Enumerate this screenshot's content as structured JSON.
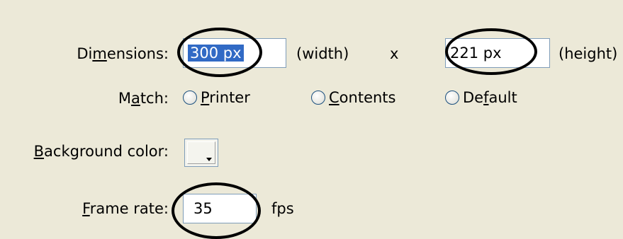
{
  "dimensions": {
    "label_prefix": "Di",
    "label_mnemonic": "m",
    "label_suffix": "ensions:",
    "width_value": "300 px",
    "width_unit": "(width)",
    "separator": "x",
    "height_value": "221 px",
    "height_unit": "(height)"
  },
  "match": {
    "label_prefix": "M",
    "label_mnemonic": "a",
    "label_suffix": "tch:",
    "options": [
      {
        "mnemonic": "P",
        "rest": "rinter"
      },
      {
        "mnemonic": "C",
        "rest": "ontents"
      },
      {
        "prefix": "De",
        "mnemonic": "f",
        "rest": "ault"
      }
    ]
  },
  "background": {
    "label_mnemonic": "B",
    "label_suffix": "ackground color:",
    "swatch_color": "#f4f4ee"
  },
  "frame_rate": {
    "label_mnemonic": "F",
    "label_suffix": "rame rate:",
    "value": "35",
    "unit": "fps"
  },
  "colors": {
    "dialog_bg": "#ece9d8",
    "field_border": "#7f9db9",
    "selection": "#316ac5"
  }
}
